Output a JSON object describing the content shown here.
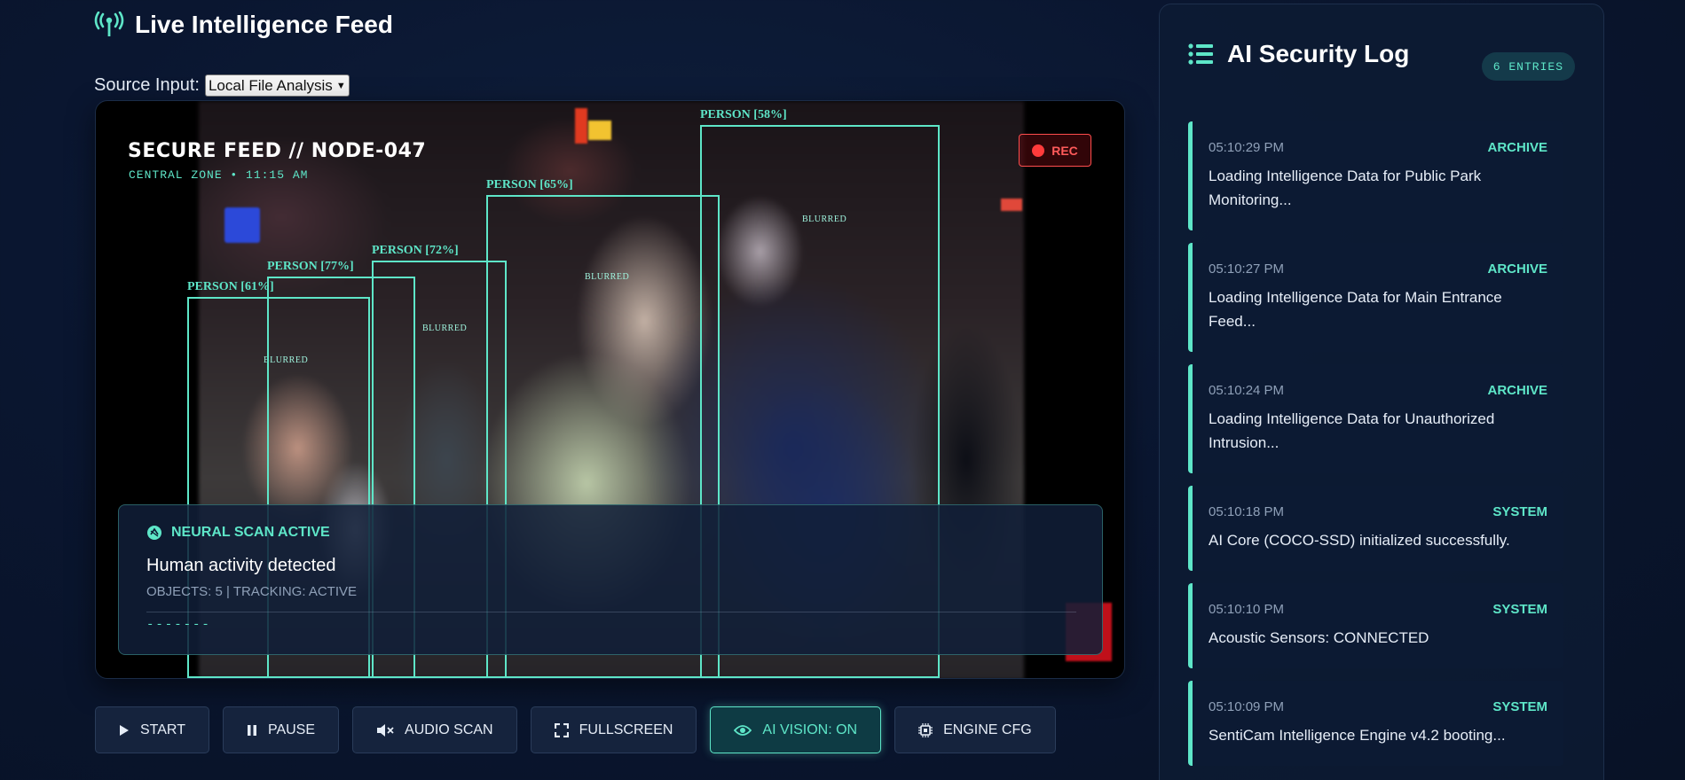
{
  "feed": {
    "title": "Live Intelligence Feed",
    "source_label": "Source Input:",
    "source_value": "Local File Analysis"
  },
  "video": {
    "feed_id": "SECURE FEED // NODE-047",
    "feed_sub": "CENTRAL ZONE • 11:15 AM",
    "rec_label": "REC",
    "detections": [
      {
        "label": "PERSON [61%]"
      },
      {
        "label": "PERSON [77%]"
      },
      {
        "label": "PERSON [72%]"
      },
      {
        "label": "PERSON [65%]"
      },
      {
        "label": "PERSON [58%]"
      }
    ],
    "blur_tag": "BLURRED"
  },
  "scan": {
    "title": "NEURAL SCAN ACTIVE",
    "message": "Human activity detected",
    "meta": "OBJECTS: 5 | TRACKING: ACTIVE",
    "dashes": "-------"
  },
  "controls": {
    "start": "START",
    "pause": "PAUSE",
    "audio_scan": "AUDIO SCAN",
    "fullscreen": "FULLSCREEN",
    "ai_vision": "AI VISION: ON",
    "engine_cfg": "ENGINE CFG"
  },
  "log": {
    "title": "AI Security Log",
    "count": "6 ENTRIES",
    "entries": [
      {
        "time": "05:10:29 PM",
        "type": "ARCHIVE",
        "message": "Loading Intelligence Data for Public Park Monitoring..."
      },
      {
        "time": "05:10:27 PM",
        "type": "ARCHIVE",
        "message": "Loading Intelligence Data for Main Entrance Feed..."
      },
      {
        "time": "05:10:24 PM",
        "type": "ARCHIVE",
        "message": "Loading Intelligence Data for Unauthorized Intrusion..."
      },
      {
        "time": "05:10:18 PM",
        "type": "SYSTEM",
        "message": "AI Core (COCO-SSD) initialized successfully."
      },
      {
        "time": "05:10:10 PM",
        "type": "SYSTEM",
        "message": "Acoustic Sensors: CONNECTED"
      },
      {
        "time": "05:10:09 PM",
        "type": "SYSTEM",
        "message": "SentiCam Intelligence Engine v4.2 booting..."
      }
    ]
  },
  "colors": {
    "accent": "#5ee6c8",
    "background": "#0a1630",
    "rec": "#ff4d4d"
  }
}
